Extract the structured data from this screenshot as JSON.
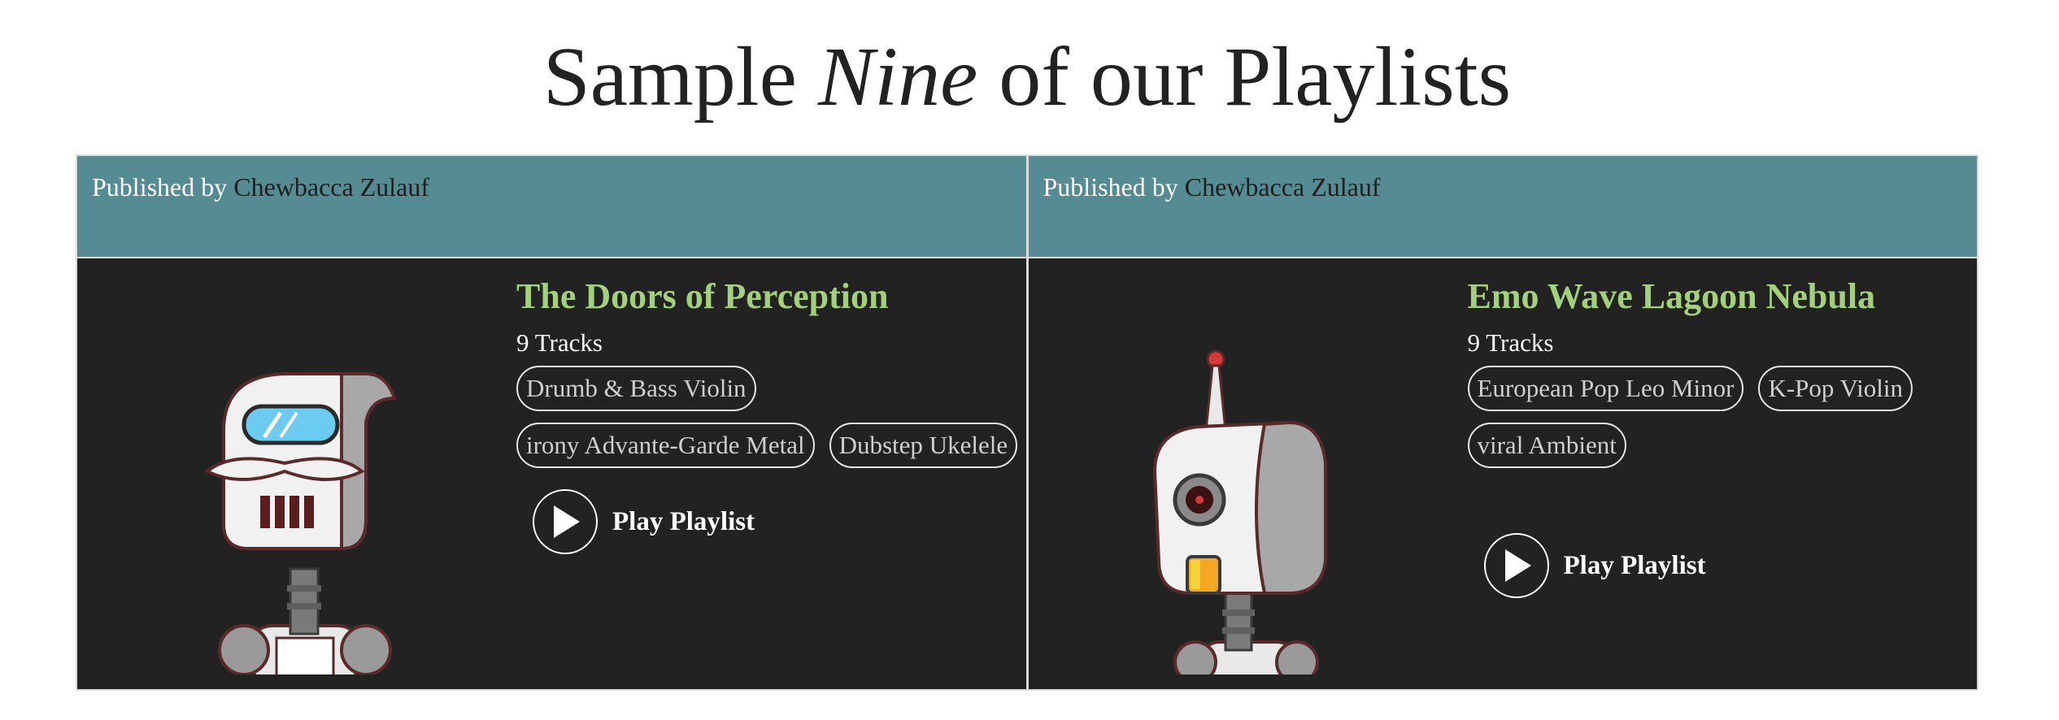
{
  "page": {
    "title_before": "Sample ",
    "title_emph": "Nine",
    "title_after": " of our Playlists"
  },
  "playlists": [
    {
      "published_label": "Published by",
      "author": "Chewbacca Zulauf",
      "title": "The Doors of Perception",
      "tracks": "9 Tracks",
      "tags": [
        "Drumb & Bass Violin",
        "irony Advante-Garde Metal",
        "Dubstep Ukelele"
      ],
      "play_label": "Play Playlist",
      "avatar_icon": "robot-mustache-icon"
    },
    {
      "published_label": "Published by",
      "author": "Chewbacca Zulauf",
      "title": "Emo Wave Lagoon Nebula",
      "tracks": "9 Tracks",
      "tags": [
        "European Pop Leo Minor",
        "K-Pop Violin",
        "viral Ambient"
      ],
      "play_label": "Play Playlist",
      "avatar_icon": "robot-cyclops-icon"
    }
  ],
  "colors": {
    "header_bg": "#558b93",
    "body_bg": "#222222",
    "title_green": "#a3d17a"
  }
}
